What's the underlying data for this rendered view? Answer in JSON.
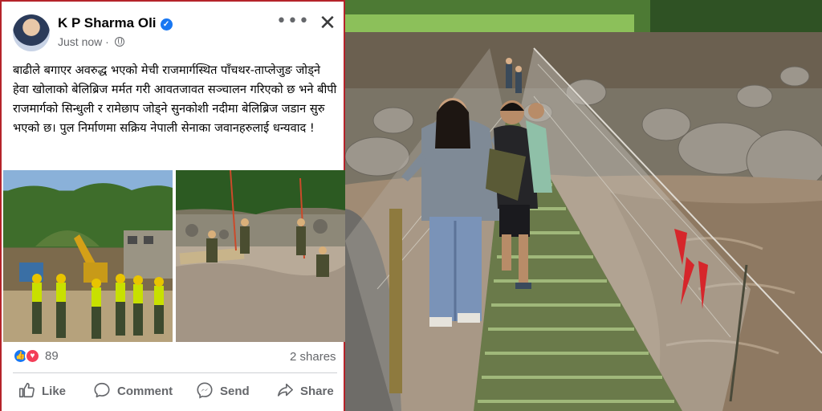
{
  "post": {
    "author": "K P Sharma Oli",
    "timestamp": "Just now",
    "body": "बाढीले बगाएर अवरुद्ध भएको मेची राजमार्गस्थित पाँचथर-ताप्लेजुङ जोड्ने हेवा खोलाको बेलिब्रिज मर्मत गरी आवतजावत सञ्चालन गरिएको छ भने बीपी राजमार्गको सिन्धुली र रामेछाप जोड्ने सुनकोशी नदीमा बेलिब्रिज जडान सुरु भएको छ। पुल निर्माणमा सक्रिय नेपाली सेनाका जवानहरुलाई धन्यवाद !",
    "reaction_count": "89",
    "shares": "2 shares",
    "icons": [
      "verified-badge-icon",
      "globe-icon",
      "more-options-icon",
      "close-icon",
      "like-reaction-icon",
      "love-reaction-icon"
    ]
  },
  "actions": {
    "like": "Like",
    "comment": "Comment",
    "send": "Send",
    "share": "Share"
  },
  "colors": {
    "brand_blue": "#1877f2",
    "love_red": "#f33e58",
    "secondary_text": "#65676b",
    "frame_red": "#b5232a"
  }
}
